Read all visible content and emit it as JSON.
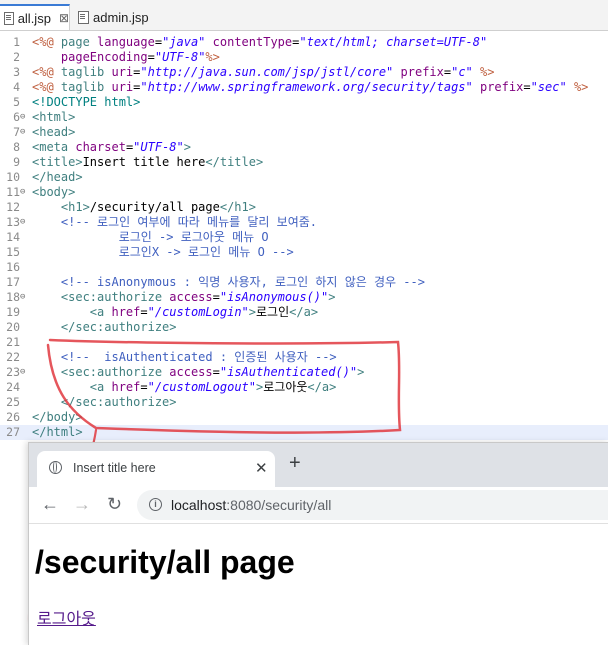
{
  "editor_tabs": [
    {
      "label": "all.jsp",
      "active": true
    },
    {
      "label": "admin.jsp",
      "active": false
    }
  ],
  "code_lines": [
    {
      "num": "1",
      "fold": "",
      "tokens": [
        [
          "dir",
          "<%@ "
        ],
        [
          "tag",
          "page "
        ],
        [
          "attr",
          "language"
        ],
        [
          "txt",
          "="
        ],
        [
          "str",
          "\"java\""
        ],
        [
          "txt",
          " "
        ],
        [
          "attr",
          "contentType"
        ],
        [
          "txt",
          "="
        ],
        [
          "str",
          "\"text/html; charset=UTF-8\""
        ]
      ]
    },
    {
      "num": "2",
      "fold": "",
      "tokens": [
        [
          "txt",
          "    "
        ],
        [
          "attr",
          "pageEncoding"
        ],
        [
          "txt",
          "="
        ],
        [
          "str",
          "\"UTF-8\""
        ],
        [
          "dir",
          "%>"
        ]
      ]
    },
    {
      "num": "3",
      "fold": "",
      "tokens": [
        [
          "dir",
          "<%@ "
        ],
        [
          "tag",
          "taglib "
        ],
        [
          "attr",
          "uri"
        ],
        [
          "txt",
          "="
        ],
        [
          "str",
          "\"http://java.sun.com/jsp/jstl/core\""
        ],
        [
          "txt",
          " "
        ],
        [
          "attr",
          "prefix"
        ],
        [
          "txt",
          "="
        ],
        [
          "str",
          "\"c\""
        ],
        [
          "txt",
          " "
        ],
        [
          "dir",
          "%>"
        ]
      ]
    },
    {
      "num": "4",
      "fold": "",
      "tokens": [
        [
          "dir",
          "<%@ "
        ],
        [
          "tag",
          "taglib "
        ],
        [
          "attr",
          "uri"
        ],
        [
          "txt",
          "="
        ],
        [
          "str",
          "\"http://www.springframework.org/security/tags\""
        ],
        [
          "txt",
          " "
        ],
        [
          "attr",
          "prefix"
        ],
        [
          "txt",
          "="
        ],
        [
          "str",
          "\"sec\""
        ],
        [
          "txt",
          " "
        ],
        [
          "dir",
          "%>"
        ]
      ]
    },
    {
      "num": "5",
      "fold": "",
      "tokens": [
        [
          "doc",
          "<!DOCTYPE html>"
        ]
      ]
    },
    {
      "num": "6",
      "fold": "⊖",
      "tokens": [
        [
          "tag",
          "<html>"
        ]
      ]
    },
    {
      "num": "7",
      "fold": "⊖",
      "tokens": [
        [
          "tag",
          "<head>"
        ]
      ]
    },
    {
      "num": "8",
      "fold": "",
      "tokens": [
        [
          "tag",
          "<meta "
        ],
        [
          "attr",
          "charset"
        ],
        [
          "txt",
          "="
        ],
        [
          "str",
          "\"UTF-8\""
        ],
        [
          "tag",
          ">"
        ]
      ]
    },
    {
      "num": "9",
      "fold": "",
      "tokens": [
        [
          "tag",
          "<title>"
        ],
        [
          "txt",
          "Insert title here"
        ],
        [
          "tag",
          "</title>"
        ]
      ]
    },
    {
      "num": "10",
      "fold": "",
      "tokens": [
        [
          "tag",
          "</head>"
        ]
      ]
    },
    {
      "num": "11",
      "fold": "⊖",
      "tokens": [
        [
          "tag",
          "<body>"
        ]
      ]
    },
    {
      "num": "12",
      "fold": "",
      "tokens": [
        [
          "txt",
          "    "
        ],
        [
          "tag",
          "<h1>"
        ],
        [
          "txt",
          "/security/all page"
        ],
        [
          "tag",
          "</h1>"
        ]
      ]
    },
    {
      "num": "13",
      "fold": "⊖",
      "tokens": [
        [
          "txt",
          "    "
        ],
        [
          "cm",
          "<!-- 로그인 여부에 따라 메뉴를 달리 보여줌."
        ]
      ]
    },
    {
      "num": "14",
      "fold": "",
      "tokens": [
        [
          "cm",
          "            로그인 -> 로그아웃 메뉴 O"
        ]
      ]
    },
    {
      "num": "15",
      "fold": "",
      "tokens": [
        [
          "cm",
          "            로그인X -> 로그인 메뉴 O -->"
        ]
      ]
    },
    {
      "num": "16",
      "fold": "",
      "tokens": []
    },
    {
      "num": "17",
      "fold": "",
      "tokens": [
        [
          "txt",
          "    "
        ],
        [
          "cm",
          "<!-- isAnonymous : 익명 사용자, 로그인 하지 않은 경우 -->"
        ]
      ]
    },
    {
      "num": "18",
      "fold": "⊖",
      "tokens": [
        [
          "txt",
          "    "
        ],
        [
          "tag",
          "<sec:authorize "
        ],
        [
          "attr",
          "access"
        ],
        [
          "txt",
          "="
        ],
        [
          "str",
          "\"isAnonymous()\""
        ],
        [
          "tag",
          ">"
        ]
      ]
    },
    {
      "num": "19",
      "fold": "",
      "tokens": [
        [
          "txt",
          "        "
        ],
        [
          "tag",
          "<a "
        ],
        [
          "attr",
          "href"
        ],
        [
          "txt",
          "="
        ],
        [
          "str",
          "\"/customLogin\""
        ],
        [
          "tag",
          ">"
        ],
        [
          "txt",
          "로그인"
        ],
        [
          "tag",
          "</a>"
        ]
      ]
    },
    {
      "num": "20",
      "fold": "",
      "tokens": [
        [
          "txt",
          "    "
        ],
        [
          "tag",
          "</sec:authorize>"
        ]
      ]
    },
    {
      "num": "21",
      "fold": "",
      "tokens": []
    },
    {
      "num": "22",
      "fold": "",
      "tokens": [
        [
          "txt",
          "    "
        ],
        [
          "cm",
          "<!--  isAuthenticated : 인증된 사용자 -->"
        ]
      ]
    },
    {
      "num": "23",
      "fold": "⊖",
      "tokens": [
        [
          "txt",
          "    "
        ],
        [
          "tag",
          "<sec:authorize "
        ],
        [
          "attr",
          "access"
        ],
        [
          "txt",
          "="
        ],
        [
          "str",
          "\"isAuthenticated()\""
        ],
        [
          "tag",
          ">"
        ]
      ]
    },
    {
      "num": "24",
      "fold": "",
      "tokens": [
        [
          "txt",
          "        "
        ],
        [
          "tag",
          "<a "
        ],
        [
          "attr",
          "href"
        ],
        [
          "txt",
          "="
        ],
        [
          "str",
          "\"/customLogout\""
        ],
        [
          "tag",
          ">"
        ],
        [
          "txt",
          "로그아웃"
        ],
        [
          "tag",
          "</a>"
        ]
      ]
    },
    {
      "num": "25",
      "fold": "",
      "tokens": [
        [
          "txt",
          "    "
        ],
        [
          "tag",
          "</sec:authorize>"
        ]
      ]
    },
    {
      "num": "26",
      "fold": "",
      "tokens": [
        [
          "tag",
          "</body>"
        ]
      ]
    },
    {
      "num": "27",
      "fold": "",
      "tokens": [
        [
          "tag",
          "</html>"
        ]
      ],
      "current": true
    }
  ],
  "syntax_colors": {
    "tag": "#3f7f7f",
    "attr": "#7f007f",
    "str": "#2a00ff",
    "dir": "#bf5f3f",
    "cm": "#3f5fbf",
    "doc": "#008080",
    "txt": "#000000"
  },
  "annotation_color": "#e0383f",
  "browser": {
    "tab_title": "Insert title here",
    "tab_close": "✕",
    "new_tab": "+",
    "back": "←",
    "forward": "→",
    "reload": "↻",
    "info": "i",
    "url_host": "localhost",
    "url_rest": ":8080/security/all",
    "page_heading": "/security/all page",
    "page_link": "로그아웃"
  }
}
